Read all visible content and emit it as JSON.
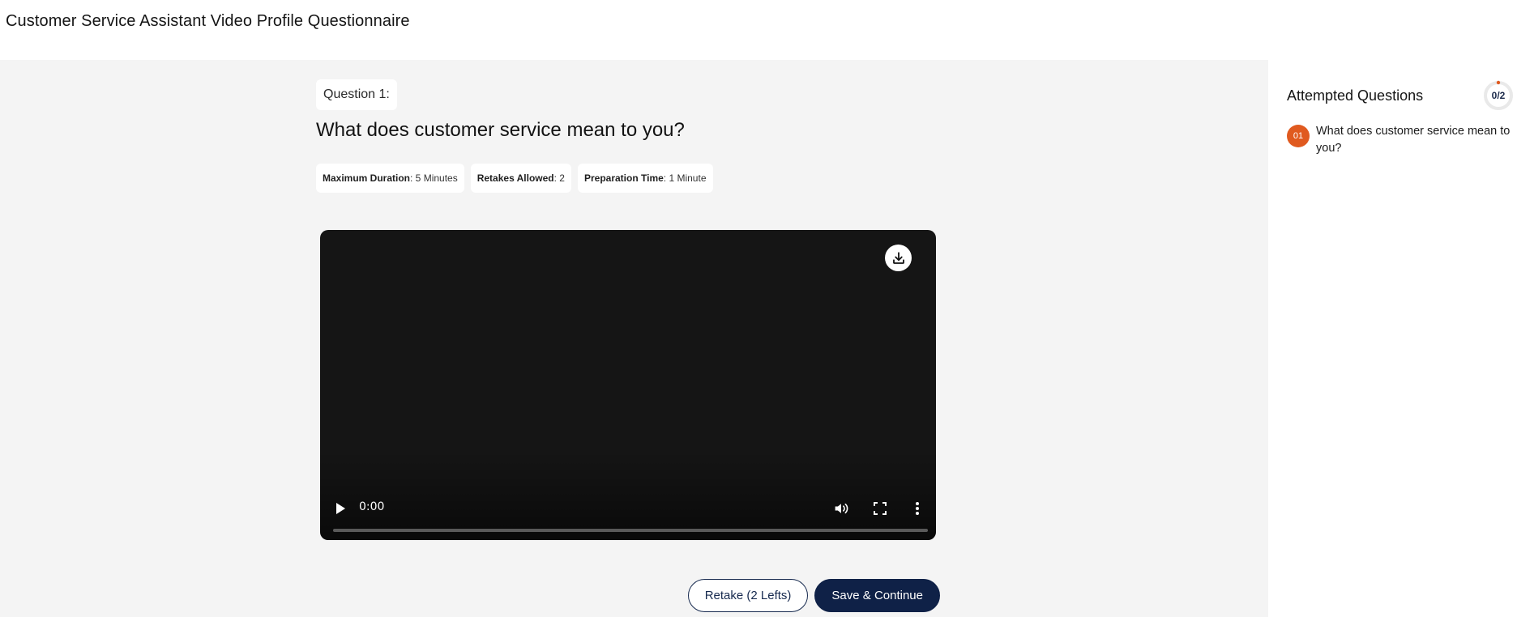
{
  "header": {
    "title": "Customer Service Assistant Video Profile Questionnaire"
  },
  "question": {
    "tag": "Question 1:",
    "text": "What does customer service mean to you?",
    "meta": [
      {
        "key": "Maximum Duration",
        "value": ": 5 Minutes"
      },
      {
        "key": "Retakes Allowed",
        "value": ": 2"
      },
      {
        "key": "Preparation Time",
        "value": ": 1 Minute"
      }
    ]
  },
  "video": {
    "current_time": "0:00",
    "progress": 0,
    "icons": {
      "download": "download-icon",
      "play": "play-icon",
      "volume": "volume-icon",
      "fullscreen": "fullscreen-icon",
      "more": "more-vertical-icon"
    }
  },
  "actions": {
    "retake_label": "Retake (2 Lefts)",
    "save_label": "Save & Continue"
  },
  "sidebar": {
    "title": "Attempted Questions",
    "progress_label": "0/2",
    "progress_fraction": 0,
    "items": [
      {
        "number": "01",
        "label": "What does customer service mean to you?"
      }
    ]
  },
  "colors": {
    "accent": "#e05a1f",
    "primary": "#0f2147",
    "background": "#f4f4f4"
  }
}
